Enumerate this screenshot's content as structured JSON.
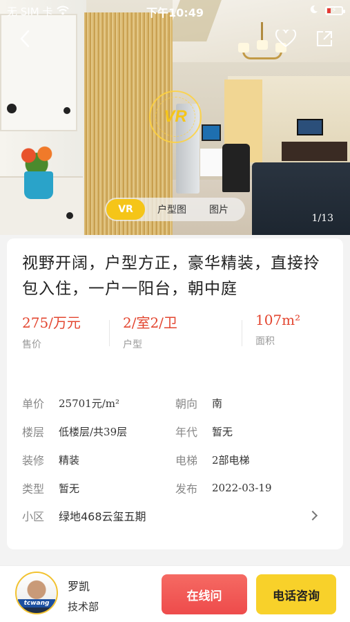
{
  "status_bar": {
    "carrier": "无 SIM 卡",
    "time": "下午10:49"
  },
  "gallery": {
    "vr_badge": "VR",
    "tabs": [
      {
        "label": "VR",
        "active": true
      },
      {
        "label": "户型图",
        "active": false
      },
      {
        "label": "图片",
        "active": false
      }
    ],
    "counter": "1/13"
  },
  "listing": {
    "title": "视野开阔，户型方正，豪华精装，直接拎包入住，一户一阳台，朝中庭",
    "stats": [
      {
        "value": "275/万元",
        "label": "售价"
      },
      {
        "value": "2/室2/卫",
        "label": "户型"
      },
      {
        "value": "107m²",
        "label": "面积"
      }
    ],
    "details": {
      "unit_price": {
        "key": "单价",
        "value": "25701元/m²"
      },
      "orientation": {
        "key": "朝向",
        "value": "南"
      },
      "floor": {
        "key": "楼层",
        "value": "低楼层/共39层"
      },
      "year": {
        "key": "年代",
        "value": "暂无"
      },
      "decoration": {
        "key": "装修",
        "value": "精装"
      },
      "elevator": {
        "key": "电梯",
        "value": "2部电梯"
      },
      "type": {
        "key": "类型",
        "value": "暂无"
      },
      "published": {
        "key": "发布",
        "value": "2022-03-19"
      },
      "community": {
        "key": "小区",
        "value": "绿地468云玺五期"
      }
    }
  },
  "agent": {
    "name": "罗凯",
    "department": "技术部",
    "avatar_tag": "tcwang"
  },
  "actions": {
    "chat_label": "在线问",
    "call_label": "电话咨询"
  },
  "colors": {
    "price_red": "#e3452f",
    "vr_yellow": "#f5c518",
    "chat_red": "#ee4b4b",
    "call_yellow": "#f8d12a"
  }
}
